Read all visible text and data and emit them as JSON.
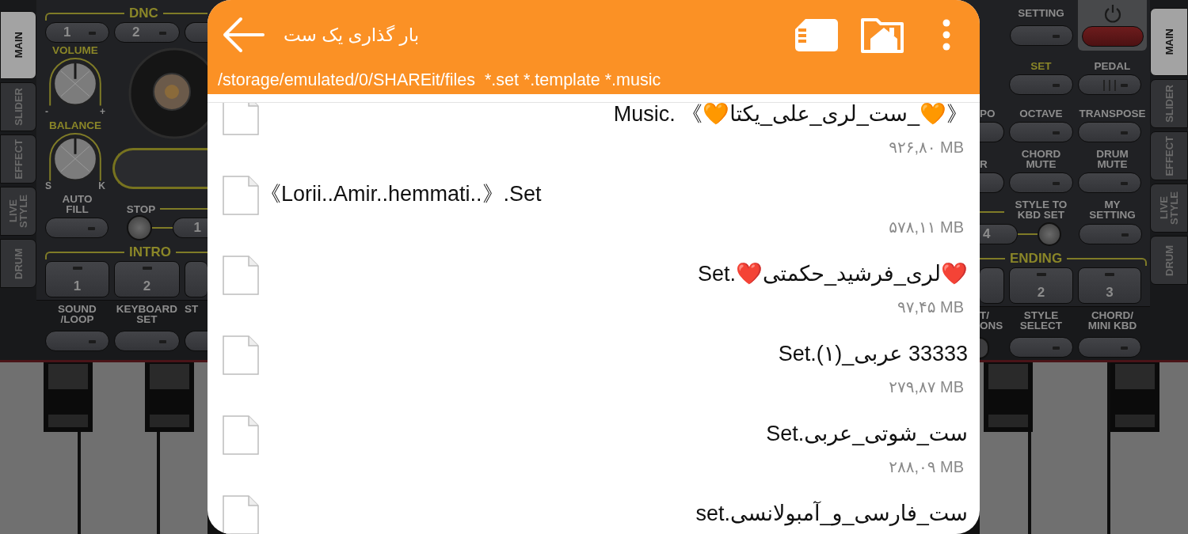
{
  "left_tabs": [
    {
      "label": "MAIN",
      "selected": true
    },
    {
      "label": "SLIDER",
      "selected": false
    },
    {
      "label": "EFFECT",
      "selected": false
    },
    {
      "label": "LIVE\nSTYLE",
      "selected": false
    },
    {
      "label": "DRUM",
      "selected": false
    }
  ],
  "left_panel": {
    "dnc": {
      "title": "DNC",
      "buttons": [
        "1",
        "2"
      ]
    },
    "volume": {
      "label": "VOLUME",
      "min": "-",
      "max": "+"
    },
    "balance": {
      "label": "BALANCE",
      "min": "S",
      "max": "K"
    },
    "auto_fill": "AUTO\nFILL",
    "stop": "STOP",
    "fill_button": "1",
    "intro": {
      "title": "INTRO",
      "buttons": [
        "1",
        "2"
      ]
    },
    "bottom_labels": [
      "SOUND\n/LOOP",
      "KEYBOARD\nSET",
      "ST"
    ]
  },
  "right_panel": {
    "setting": "SETTING",
    "set": "SET",
    "pedal": "PEDAL",
    "labels_1": [
      "PO",
      "OCTAVE",
      "TRANSPOSE"
    ],
    "labels_2": [
      "R",
      "CHORD\nMUTE",
      "DRUM\nMUTE"
    ],
    "labels_3": [
      "STYLE TO\nKBD SET",
      "MY\nSETTING"
    ],
    "fill_button": "4",
    "ending": {
      "title": "ENDING",
      "buttons": [
        "2",
        "3"
      ]
    },
    "bottom_labels": [
      "T/\nONS",
      "STYLE\nSELECT",
      "CHORD/\nMINI KBD"
    ]
  },
  "right_tabs": [
    {
      "label": "MAIN",
      "selected": true
    },
    {
      "label": "SLIDER",
      "selected": false
    },
    {
      "label": "EFFECT",
      "selected": false
    },
    {
      "label": "LIVE\nSTYLE",
      "selected": false
    },
    {
      "label": "DRUM",
      "selected": false
    }
  ],
  "dialog": {
    "title": "بار گذاری یک ست",
    "path": "/storage/emulated/0/SHAREit/files  *.set *.template *.music",
    "files": [
      {
        "name": "《🧡_ست_لری_علی_یکتا🧡》 .Music",
        "size": "۹۲۶,۸۰ MB"
      },
      {
        "name": "《Lorii..Amir..hemmati..》.Set",
        "size": "۵۷۸,۱۱ MB"
      },
      {
        "name": "❤️لری_فرشید_حکمتی❤️.Set",
        "size": "۹۷,۴۵ MB"
      },
      {
        "name": "33333  عربی_(۱).Set",
        "size": "۲۷۹,۸۷ MB"
      },
      {
        "name": "ست_شوتی_عربی.Set",
        "size": "۲۸۸,۰۹ MB"
      },
      {
        "name": "ست_فارسی_و_آمبولانسی.set"
      }
    ]
  }
}
